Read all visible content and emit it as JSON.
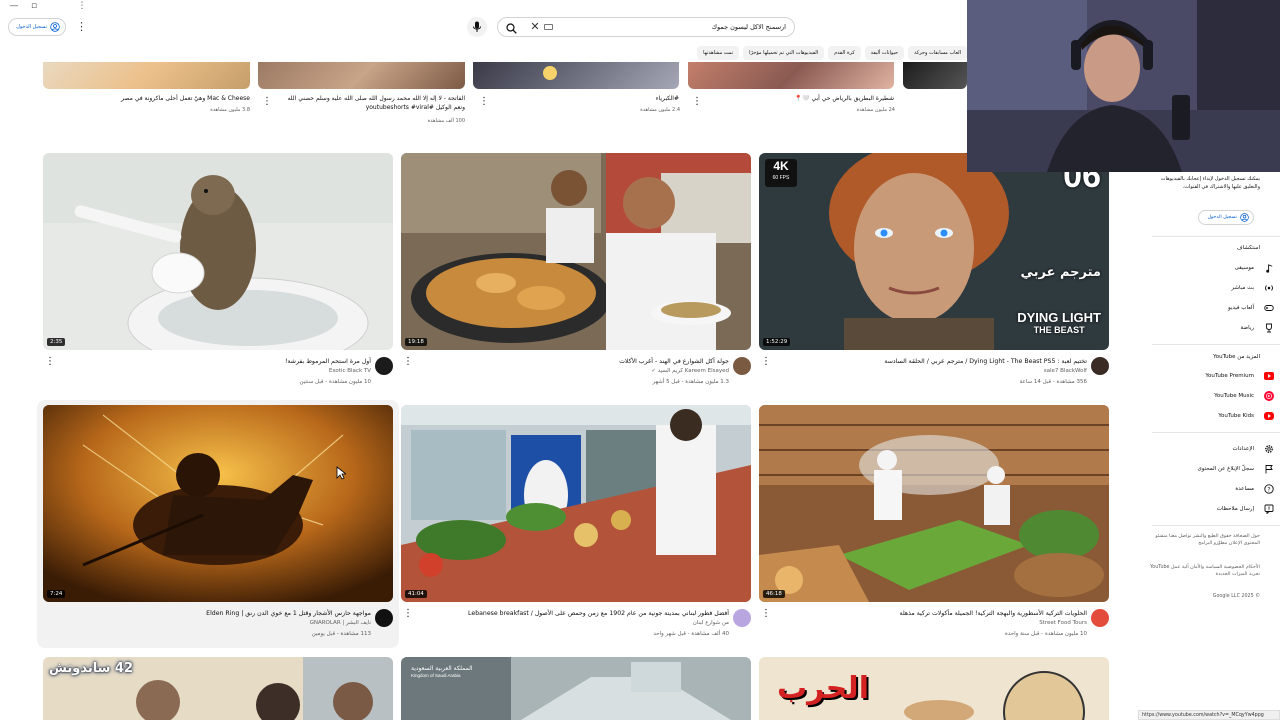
{
  "window": {
    "minimize": "—",
    "restore": "▫",
    "more": "⋮"
  },
  "topbar": {
    "signin_label": "تسجيل الدخول",
    "search_value": "ارسمنج الاكل ليسون جموك",
    "icons": [
      "user-circle-icon",
      "kebab-icon",
      "mic-icon",
      "search-icon",
      "close-icon",
      "keyboard-icon"
    ]
  },
  "chips": [
    "العاب مسابقات وحركة",
    "حيوانات أليفة",
    "كرة القدم",
    "الفيديوهات التي تم تحميلها مؤخرًا",
    "تمت مشاهدتها"
  ],
  "row0": [
    {
      "title": "Mac & Cheese وهيّ تعمل أحلى ماكرونة في مصر",
      "views": "3.8 مليون مشاهدة",
      "colors": [
        "#e9d9c0",
        "#ecc08a",
        "#c59e6a"
      ]
    },
    {
      "title": "الفاتحة - لا إله إلا الله محمد رسول الله صلى الله عليه وسلم حصني الله ونعم الوكيل #youtubeshorts #viral",
      "views": "100 ألف مشاهدة",
      "colors": [
        "#9b7a64",
        "#c8a488",
        "#7c5a45"
      ]
    },
    {
      "title": "#الكبرياء",
      "views": "2.4 مليون مشاهدة",
      "colors": [
        "#3a3a48",
        "#6d6f7e",
        "#a6a7b6"
      ]
    },
    {
      "title": "شطيرة البطريق بالرياض حي أبي 🤍📍",
      "views": "24 مليون مشاهدة",
      "colors": [
        "#c37f6a",
        "#8a5a52",
        "#e0b3a2"
      ]
    },
    {
      "title": "",
      "views": "",
      "colors": [
        "#1b1b1b",
        "#3a3a3a",
        "#555"
      ]
    }
  ],
  "videos": [
    {
      "title": "أول مرة استحم المرموط بفرشة!",
      "channel": "Exotic Black TV",
      "meta": "10 مليون مشاهدة - قبل سنتين",
      "duration": "2:35",
      "thumb_colors": [
        "#e9ece9",
        "#c9cfcb",
        "#8b7a62"
      ],
      "avatar_color": "#1b1b1b"
    },
    {
      "title": "جولة أكل الشوارع في الهند - أغرب الأكلات",
      "channel": "Kareem Elsayed كريم السيد ✓",
      "meta": "1.3 مليون مشاهدة - قبل 5 أشهر",
      "duration": "19:18",
      "thumb_colors": [
        "#d9c29a",
        "#a86f3a",
        "#5d4630"
      ],
      "avatar_color": "#7a5a40"
    },
    {
      "title": "تختيم لعبة : Dying Light - The Beast PS5 / مترجم عربي / الحلقة السادسة",
      "channel": "sale7 BlackWolf",
      "meta": "356 مشاهدة - قبل 14 ساعة",
      "duration": "1:52:29",
      "thumb_colors": [
        "#c7924f",
        "#6e4a2c",
        "#2e3c46"
      ],
      "avatar_color": "#3a2c24",
      "badge_4k": "4K",
      "badge_fps": "60 FPS",
      "episode": "06",
      "overlay_ar": "مترجم عربي",
      "game_title": "DYING LIGHT",
      "game_sub": "THE BEAST"
    },
    {
      "title": "مواجهة حارس الأشجار وقتل 1 مع خوي الدن رنق | Elden Ring",
      "channel": "نايف البشر | GNAROLAR",
      "meta": "113 مشاهدة - قبل يومين",
      "duration": "7:24",
      "thumb_colors": [
        "#f2b340",
        "#a15c12",
        "#3b1e06"
      ],
      "avatar_color": "#111"
    },
    {
      "title": "أفضل فطور لبناني بمدينة جونية من عام 1902 مع زمن وحمص على الأصول / Lebanese breakfast",
      "channel": "من شوارع لبنان",
      "meta": "40 ألف مشاهدة - قبل شهر واحد",
      "duration": "41:04",
      "thumb_colors": [
        "#c9d6db",
        "#7b8f8c",
        "#b9462e"
      ],
      "avatar_color": "#b9a6e0"
    },
    {
      "title": "الحلويات التركية الأسطورية والبهجة التركية! الجميلة مأكولات تركية مذهلة",
      "channel": "Street Food Tours",
      "meta": "10 مليون مشاهدة - قبل سنة واحدة",
      "duration": "46:18",
      "thumb_colors": [
        "#c48a5a",
        "#6f4126",
        "#3d6e2c"
      ],
      "avatar_color": "#e34b3a"
    }
  ],
  "row3": [
    {
      "overlay": "42 ساندوتش",
      "colors": [
        "#e4d3b0",
        "#6f5e4b",
        "#a0acb0"
      ]
    },
    {
      "overlay": "المملكة العربية السعودية",
      "overlay_en": "Kingdom of Saudi Arabia",
      "colors": [
        "#9aa8ad",
        "#cdd6d8",
        "#6c7a7e"
      ]
    },
    {
      "overlay": "الحرب",
      "colors": [
        "#e8dcc8",
        "#c89c6a",
        "#8a6446"
      ]
    }
  ],
  "sidebar": {
    "promo_text": "يمكنك تسجيل الدخول لإبداء إعجابك بالفيديوهات والتعليق عليها والاشتراك في القنوات.",
    "signin_label": "تسجيل الدخول",
    "explore_heading": "استكشاف",
    "explore": [
      {
        "label": "موسيقى",
        "icon": "music-note-icon"
      },
      {
        "label": "بث مباشر",
        "icon": "live-icon"
      },
      {
        "label": "ألعاب فيديو",
        "icon": "gamepad-icon"
      },
      {
        "label": "رياضة",
        "icon": "trophy-icon"
      }
    ],
    "more_heading": "المزيد من YouTube",
    "more": [
      {
        "label": "YouTube Premium",
        "icon": "yt-premium-icon",
        "color": "#ff0000"
      },
      {
        "label": "YouTube Music",
        "icon": "yt-music-icon",
        "color": "#ff0033"
      },
      {
        "label": "YouTube Kids",
        "icon": "yt-kids-icon",
        "color": "#ff0000"
      }
    ],
    "settings": [
      {
        "label": "الإعدادات",
        "icon": "gear-icon"
      },
      {
        "label": "سجلّ الإبلاغ عن المحتوى",
        "icon": "flag-icon"
      },
      {
        "label": "مساعدة",
        "icon": "help-icon"
      },
      {
        "label": "إرسال ملاحظات",
        "icon": "feedback-icon"
      }
    ],
    "footer1": "حول الصحافة حقوق الطبع والنشر تواصل معنا منشئو المحتوى الإعلان مطوّرو البرامج",
    "footer2": "الأحكام الخصوصية السياسة والأمان آلية عمل YouTube تجربة الميزات الجديدة",
    "copyright": "© 2025 Google LLC",
    "status_url": "https://www.youtube.com/watch?v=_MCqyYw4ppg"
  }
}
